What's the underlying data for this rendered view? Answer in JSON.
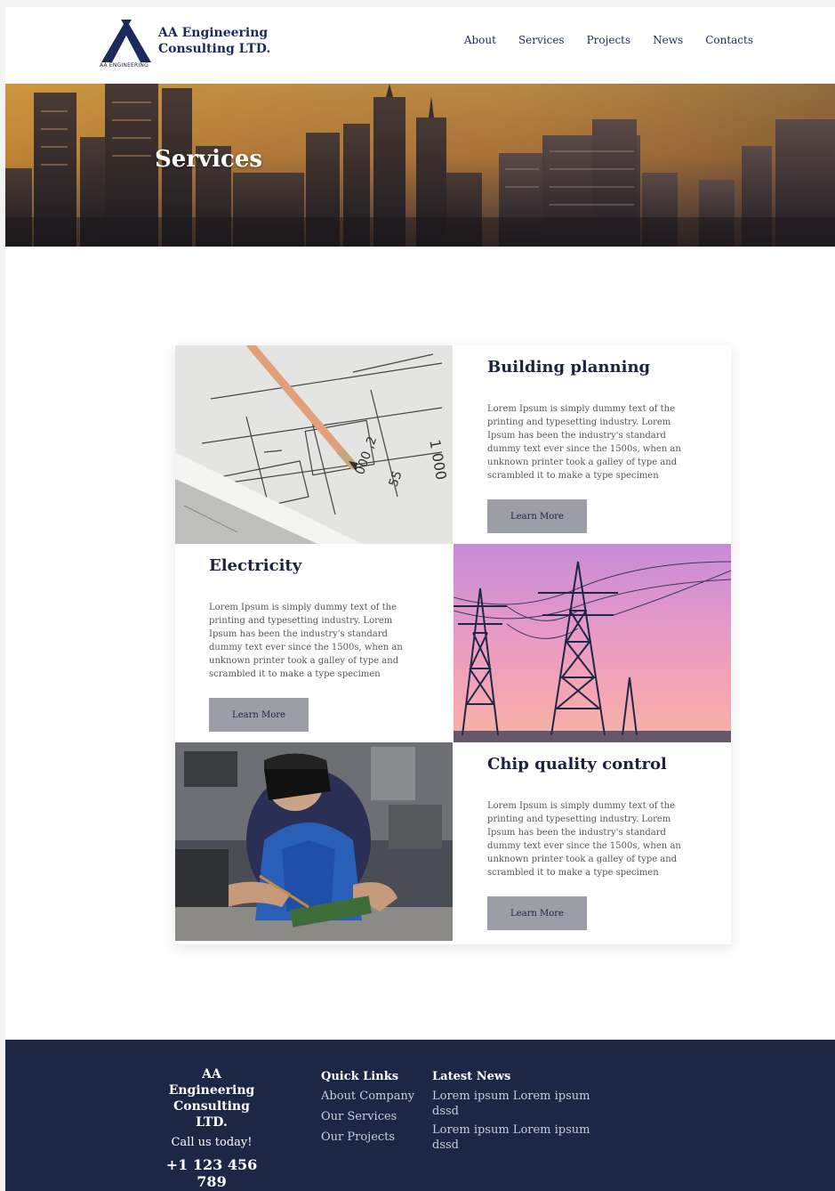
{
  "brand": {
    "name_line1": "AA Engineering",
    "name_line2": "Consulting LTD.",
    "logo_caption": "AA ENGINEERING",
    "accent": "#1b2a5c"
  },
  "nav": {
    "items": [
      "About",
      "Services",
      "Projects",
      "News",
      "Contacts"
    ]
  },
  "hero": {
    "title": "Services"
  },
  "services": [
    {
      "title": "Building planning",
      "text": "Lorem Ipsum is simply dummy text of the printing and typesetting industry. Lorem Ipsum has been the industry's standard dummy text ever since the 1500s, when an unknown printer took a galley of type and scrambled it to make a type specimen",
      "button": "Learn More",
      "image": "blueprint-pencil-photo"
    },
    {
      "title": "Electricity",
      "text": "Lorem Ipsum is simply dummy text of the printing and typesetting industry. Lorem Ipsum has been the industry's standard dummy text ever since the 1500s, when an unknown printer took a galley of type and scrambled it to make a type specimen",
      "button": "Learn More",
      "image": "power-towers-photo"
    },
    {
      "title": "Chip quality control",
      "text": "Lorem Ipsum is simply dummy text of the printing and typesetting industry. Lorem Ipsum has been the industry's standard dummy text ever since the 1500s, when an unknown printer took a galley of type and scrambled it to make a type specimen",
      "button": "Learn More",
      "image": "technician-soldering-photo"
    }
  ],
  "footer": {
    "company_line1": "AA Engineering",
    "company_line2": "Consulting LTD.",
    "call": "Call us today!",
    "phone": "+1 123 456 789",
    "quick_links_title": "Quick Links",
    "quick_links": [
      "About Company",
      "Our Services",
      "Our Projects"
    ],
    "news_title": "Latest News",
    "news": [
      "Lorem ipsum Lorem ipsum dssd",
      "Lorem ipsum Lorem ipsum dssd"
    ],
    "background": "#1c2746"
  }
}
